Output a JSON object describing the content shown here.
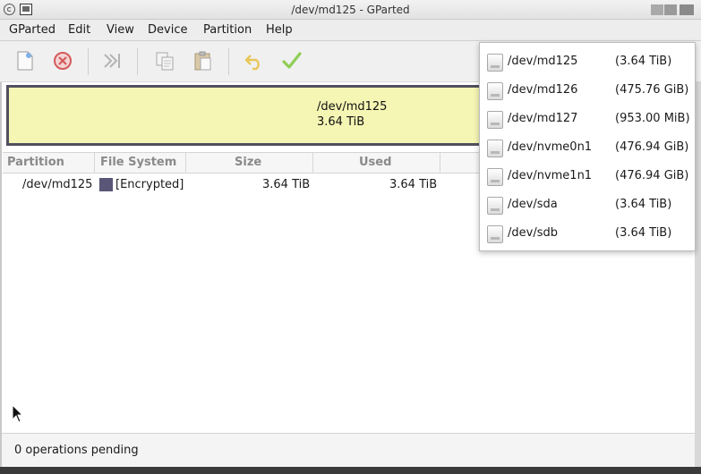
{
  "window": {
    "title": "/dev/md125 - GParted"
  },
  "menubar": {
    "items": [
      "GParted",
      "Edit",
      "View",
      "Device",
      "Partition",
      "Help"
    ]
  },
  "toolbar": {
    "icons": [
      "new-partition-icon",
      "delete-icon",
      "resize-move-icon",
      "copy-icon",
      "paste-icon",
      "undo-icon",
      "apply-icon"
    ]
  },
  "disk_graphic": {
    "name": "/dev/md125",
    "size": "3.64 TiB",
    "fill_color": "#f5f5b4"
  },
  "table": {
    "headers": [
      "Partition",
      "File System",
      "Size",
      "Used"
    ],
    "rows": [
      {
        "partition": "/dev/md125",
        "filesystem": "[Encrypted]",
        "size": "3.64 TiB",
        "used": "3.64 TiB",
        "fs_color": "#5a5678"
      }
    ]
  },
  "devices_menu": {
    "items": [
      {
        "name": "/dev/md125",
        "size": "(3.64 TiB)"
      },
      {
        "name": "/dev/md126",
        "size": "(475.76 GiB)"
      },
      {
        "name": "/dev/md127",
        "size": "(953.00 MiB)"
      },
      {
        "name": "/dev/nvme0n1",
        "size": "(476.94 GiB)"
      },
      {
        "name": "/dev/nvme1n1",
        "size": "(476.94 GiB)"
      },
      {
        "name": "/dev/sda",
        "size": "(3.64 TiB)"
      },
      {
        "name": "/dev/sdb",
        "size": "(3.64 TiB)"
      }
    ]
  },
  "statusbar": {
    "text": "0 operations pending"
  }
}
